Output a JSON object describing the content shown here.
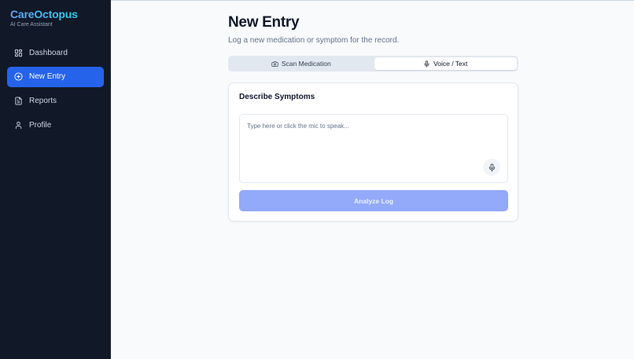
{
  "brand": {
    "title": "CareOctopus",
    "subtitle": "AI Care Assistant"
  },
  "sidebar": {
    "items": [
      {
        "label": "Dashboard",
        "icon": "dashboard-icon",
        "active": false
      },
      {
        "label": "New Entry",
        "icon": "plus-circle-icon",
        "active": true
      },
      {
        "label": "Reports",
        "icon": "document-icon",
        "active": false
      },
      {
        "label": "Profile",
        "icon": "user-icon",
        "active": false
      }
    ]
  },
  "main": {
    "title": "New Entry",
    "subtitle": "Log a new medication or symptom for the record.",
    "tabs": [
      {
        "label": "Scan Medication",
        "icon": "camera-icon",
        "active": false
      },
      {
        "label": "Voice / Text",
        "icon": "mic-icon",
        "active": true
      }
    ],
    "card": {
      "title": "Describe Symptoms",
      "textarea_value": "",
      "textarea_placeholder": "Type here or click the mic to speak...",
      "analyze_label": "Analyze Log",
      "analyze_disabled": true
    }
  },
  "colors": {
    "sidebar_bg": "#111827",
    "accent": "#2563eb",
    "brand_gradient_start": "#60a5fa",
    "brand_gradient_end": "#22d3ee",
    "button_disabled": "#93a9f9",
    "page_bg": "#f8fafc"
  }
}
